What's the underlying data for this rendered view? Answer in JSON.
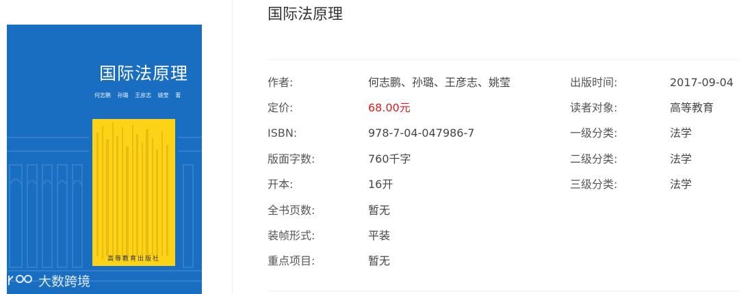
{
  "cover": {
    "title": "国际法原理",
    "authors": [
      "何志鹏",
      "孙璐",
      "王彦志",
      "姚莹",
      "著"
    ],
    "publisher": "高等教育出版社",
    "colors": {
      "background": "#1a6ec2",
      "panel": "#fcd316"
    }
  },
  "watermark": {
    "text": "大数跨境",
    "icon": "brand-logo-icon"
  },
  "book": {
    "title": "国际法原理",
    "price_color": "#e21a1a",
    "left_fields": [
      {
        "label": "作者:",
        "value": "何志鹏、孙璐、王彦志、姚莹"
      },
      {
        "label": "定价:",
        "value": "68.00元"
      },
      {
        "label": "ISBN:",
        "value": "978-7-04-047986-7"
      },
      {
        "label": "版面字数:",
        "value": "760千字"
      },
      {
        "label": "开本:",
        "value": "16开"
      },
      {
        "label": "全书页数:",
        "value": "暂无"
      },
      {
        "label": "装帧形式:",
        "value": "平装"
      },
      {
        "label": "重点项目:",
        "value": "暂无"
      }
    ],
    "right_fields": [
      {
        "label": "出版时间:",
        "value": "2017-09-04"
      },
      {
        "label": "读者对象:",
        "value": "高等教育"
      },
      {
        "label": "一级分类:",
        "value": "法学"
      },
      {
        "label": "二级分类:",
        "value": "法学"
      },
      {
        "label": "三级分类:",
        "value": "法学"
      }
    ]
  }
}
